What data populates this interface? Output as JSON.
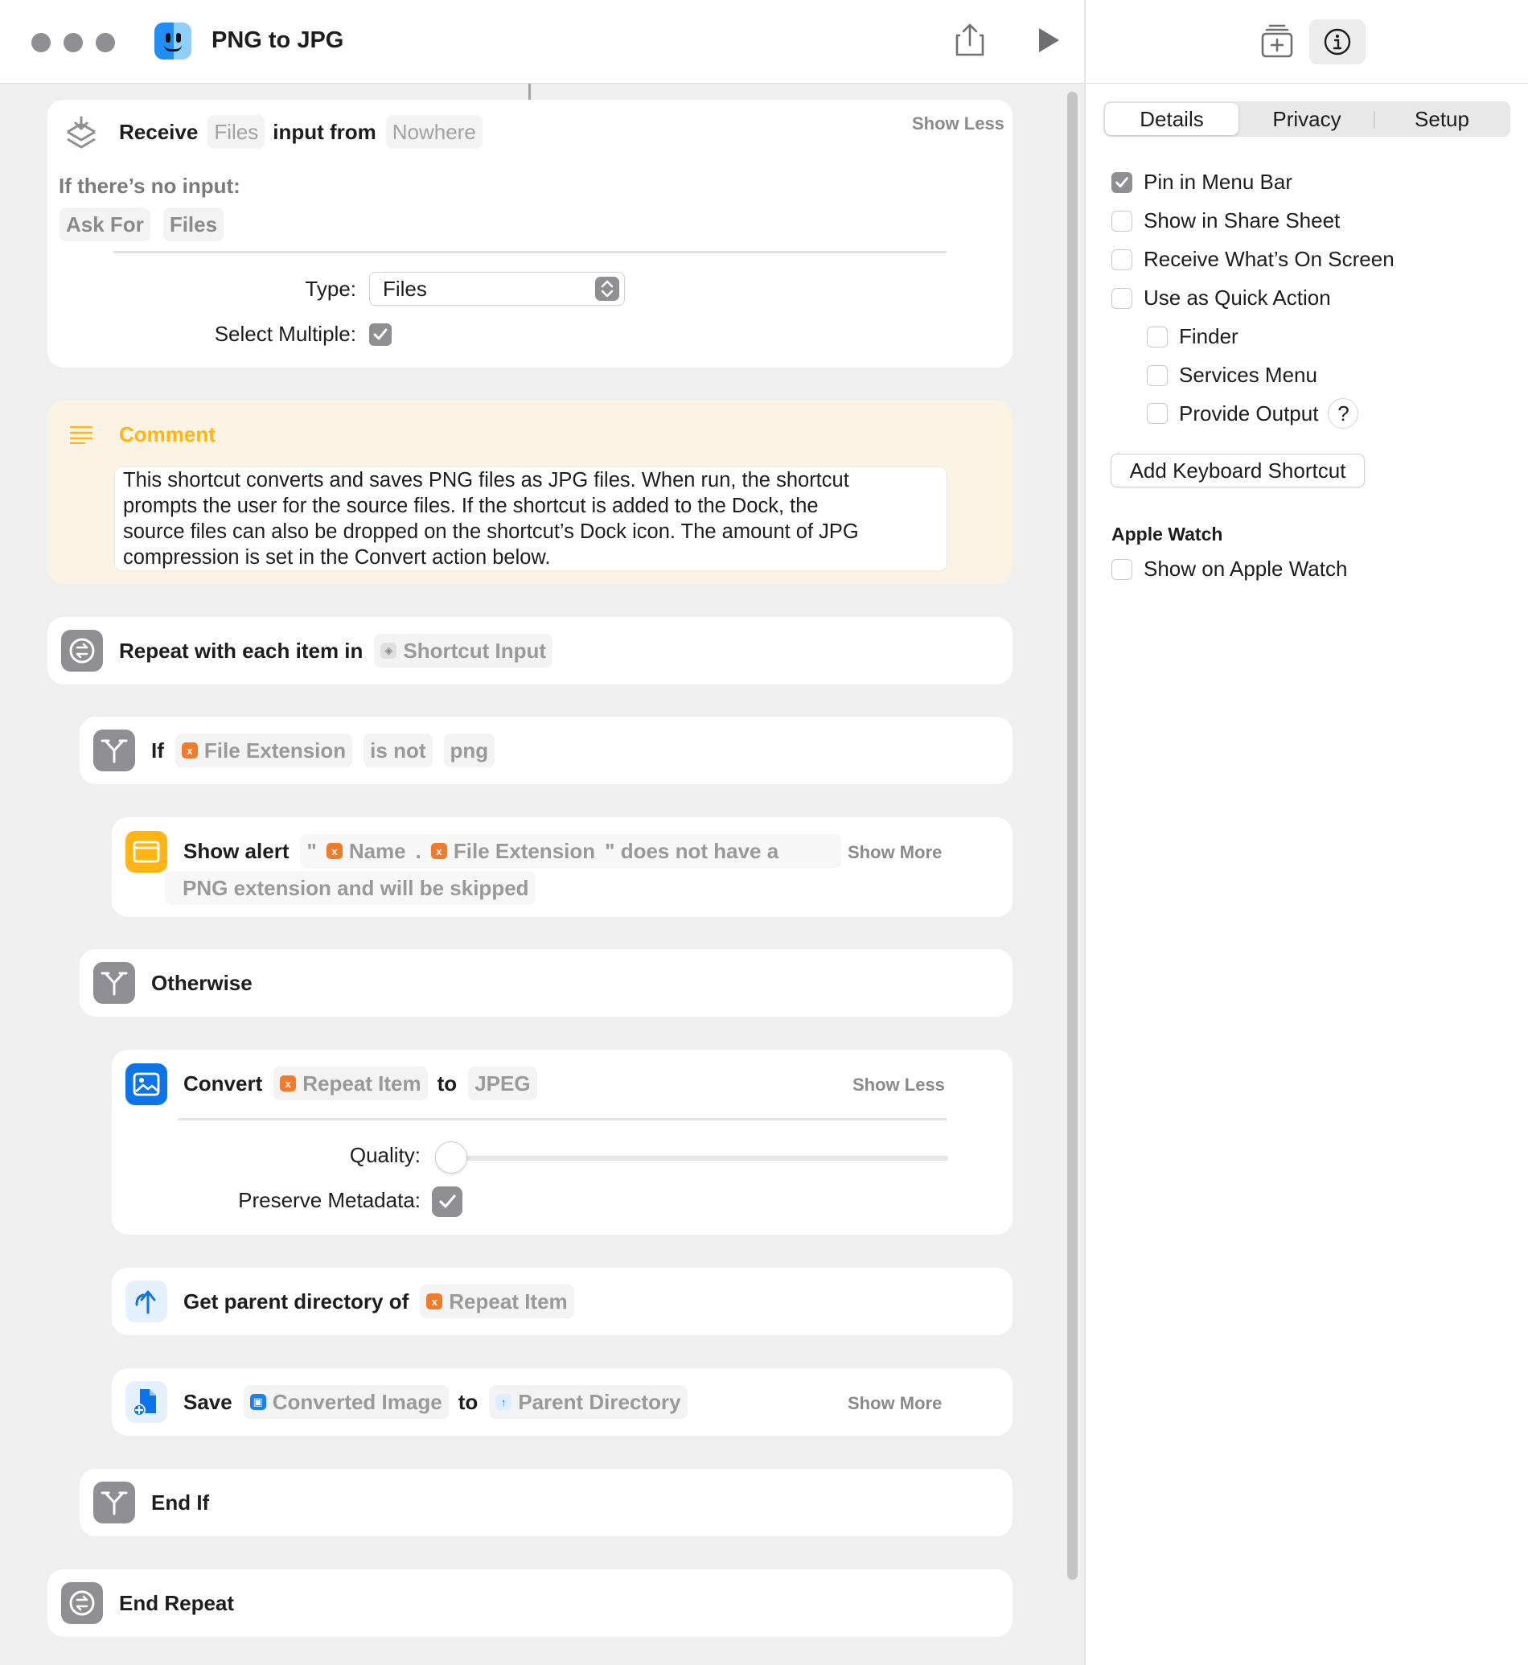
{
  "window": {
    "title": "PNG to JPG"
  },
  "editor": {
    "receive": {
      "label": "Receive",
      "type_token": "Files",
      "input_from_label": "input from",
      "source_token": "Nowhere",
      "toggle_label": "Show Less",
      "no_input_label": "If there’s no input:",
      "fallback_action": "Ask For",
      "fallback_type": "Files",
      "type_label": "Type:",
      "type_value": "Files",
      "select_multiple_label": "Select Multiple:",
      "select_multiple": true
    },
    "comment": {
      "title": "Comment",
      "lines": [
        "This shortcut converts and saves PNG files as JPG files. When run, the shortcut",
        "prompts the user for the source files. If the shortcut is added to the Dock, the",
        "source files can also be dropped on the shortcut’s Dock icon. The amount of JPG",
        "compression is set in the Convert action below."
      ]
    },
    "repeat": {
      "label": "Repeat with each item in",
      "token": "Shortcut Input"
    },
    "if": {
      "label": "If",
      "var": "File Extension",
      "condition": "is not",
      "value": "png"
    },
    "alert": {
      "label": "Show alert",
      "quote_open": "\"",
      "var_name": "Name",
      "dot": ".",
      "var_ext": "File Extension",
      "text_part1": "\" does not have a",
      "text_part2": "PNG extension and will be skipped",
      "toggle_label": "Show More"
    },
    "otherwise": {
      "label": "Otherwise"
    },
    "convert": {
      "label": "Convert",
      "var": "Repeat Item",
      "to_label": "to",
      "format": "JPEG",
      "toggle_label": "Show Less",
      "quality_label": "Quality:",
      "quality": 0.0,
      "preserve_label": "Preserve Metadata:",
      "preserve": true
    },
    "parent": {
      "label": "Get parent directory of",
      "var": "Repeat Item"
    },
    "save": {
      "label": "Save",
      "var": "Converted Image",
      "to_label": "to",
      "dest": "Parent Directory",
      "toggle_label": "Show More"
    },
    "end_if": {
      "label": "End If"
    },
    "end_repeat": {
      "label": "End Repeat"
    }
  },
  "inspector": {
    "tabs": [
      {
        "label": "Details",
        "active": true
      },
      {
        "label": "Privacy",
        "active": false
      },
      {
        "label": "Setup",
        "active": false
      }
    ],
    "options": {
      "pin_menu_bar": {
        "label": "Pin in Menu Bar",
        "checked": true
      },
      "share_sheet": {
        "label": "Show in Share Sheet",
        "checked": false
      },
      "receive_screen": {
        "label": "Receive What’s On Screen",
        "checked": false
      },
      "quick_action": {
        "label": "Use as Quick Action",
        "checked": false
      },
      "finder": {
        "label": "Finder",
        "checked": false
      },
      "services_menu": {
        "label": "Services Menu",
        "checked": false
      },
      "provide_output": {
        "label": "Provide Output",
        "checked": false
      }
    },
    "help_glyph": "?",
    "keyboard_button": "Add Keyboard Shortcut",
    "watch_section": "Apple Watch",
    "show_on_watch": {
      "label": "Show on Apple Watch",
      "checked": false
    }
  },
  "icons": {
    "variable_glyph": "x",
    "colors": {
      "accent_blue": "#0a74e8",
      "variable_orange": "#f27a2b",
      "comment_yellow": "#ffb515",
      "control_gray": "#8e8e93"
    }
  }
}
